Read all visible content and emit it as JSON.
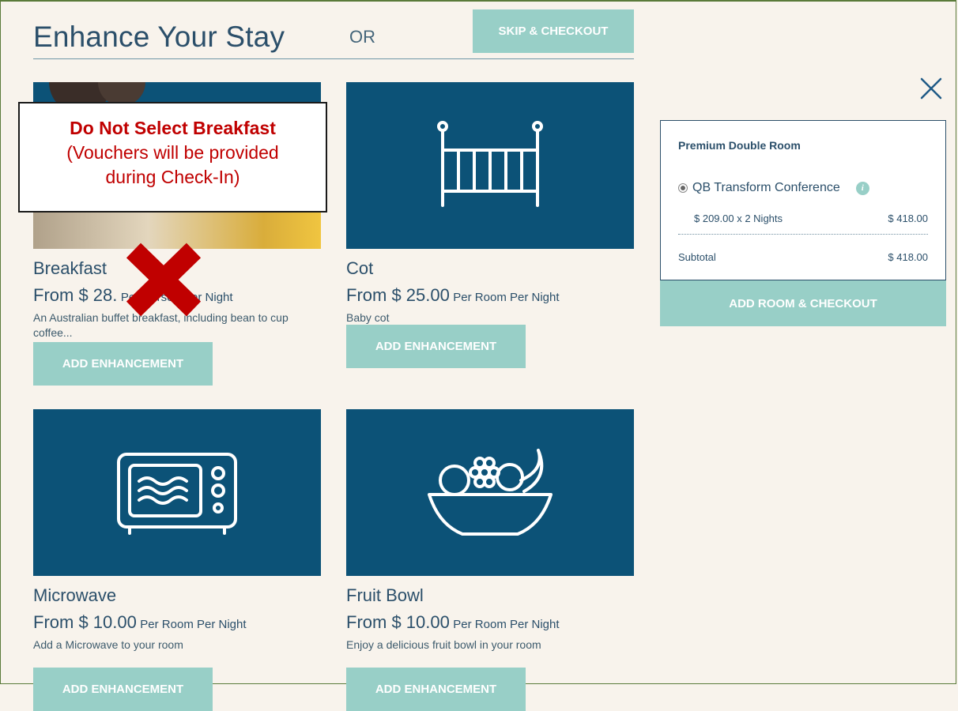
{
  "header": {
    "title": "Enhance Your Stay",
    "or_label": "OR",
    "skip_label": "SKIP & CHECKOUT"
  },
  "notice": {
    "line1": "Do Not Select Breakfast",
    "line2": "(Vouchers will be provided",
    "line3": "during Check-In)"
  },
  "enhancements": [
    {
      "name": "Breakfast",
      "price": "From $ 28.",
      "per": "Per Person Per Night",
      "description": "An Australian buffet breakfast, including bean to cup coffee...",
      "button": "ADD ENHANCEMENT"
    },
    {
      "name": "Cot",
      "price": "From $ 25.00",
      "per": "Per Room Per Night",
      "description": "Baby cot",
      "button": "ADD ENHANCEMENT"
    },
    {
      "name": "Microwave",
      "price": "From $ 10.00",
      "per": "Per Room Per Night",
      "description": "Add a Microwave to your room",
      "button": "ADD ENHANCEMENT"
    },
    {
      "name": "Fruit Bowl",
      "price": "From $ 10.00",
      "per": "Per Room Per Night",
      "description": "Enjoy a delicious fruit bowl in your room",
      "button": "ADD ENHANCEMENT"
    }
  ],
  "summary": {
    "room": "Premium Double Room",
    "rate": "QB Transform Conference",
    "nights": "$ 209.00 x 2 Nights",
    "nights_amount": "$ 418.00",
    "subtotal_label": "Subtotal",
    "subtotal_amount": "$ 418.00",
    "checkout_label": "ADD ROOM & CHECKOUT"
  },
  "colors": {
    "accent": "#98cfc7",
    "tile": "#0c5277",
    "text": "#2b4f6a",
    "warning": "#c00000",
    "background": "#f8f3ec"
  },
  "icons": {
    "close": "close-icon",
    "cot": "cot-icon",
    "microwave": "microwave-icon",
    "fruit_bowl": "fruit-bowl-icon",
    "info": "info-icon",
    "cross": "red-x-mark-icon"
  }
}
